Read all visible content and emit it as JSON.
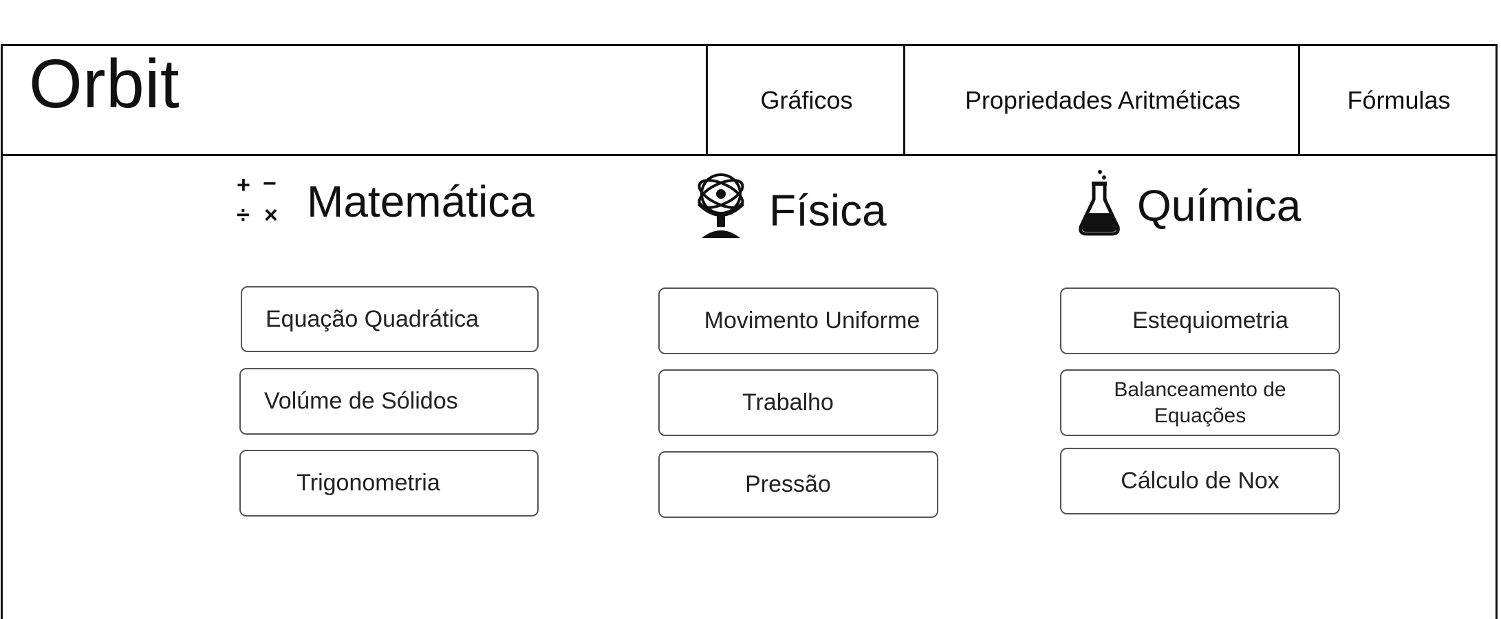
{
  "app": {
    "brand": "Orbit"
  },
  "nav": {
    "items": [
      {
        "label": "Gráficos"
      },
      {
        "label": "Propriedades Aritméticas"
      },
      {
        "label": "Fórmulas"
      }
    ]
  },
  "sections": [
    {
      "title": "Matemática",
      "icon": "math-operators-icon",
      "icon_glyphs": [
        "+",
        "−",
        "÷",
        "×"
      ],
      "buttons": [
        {
          "label": "Equação Quadrática"
        },
        {
          "label": "Volúme de Sólidos"
        },
        {
          "label": "Trigonometria"
        }
      ]
    },
    {
      "title": "Física",
      "icon": "gyroscope-atom-icon",
      "buttons": [
        {
          "label": "Movimento Uniforme"
        },
        {
          "label": "Trabalho"
        },
        {
          "label": "Pressão"
        }
      ]
    },
    {
      "title": "Química",
      "icon": "flask-icon",
      "buttons": [
        {
          "label": "Estequiometria"
        },
        {
          "label": "Balanceamento de Equações"
        },
        {
          "label": "Cálculo de Nox"
        }
      ]
    }
  ],
  "colors": {
    "border": "#111111",
    "button_border": "#555555",
    "text": "#111111",
    "background": "#ffffff"
  }
}
